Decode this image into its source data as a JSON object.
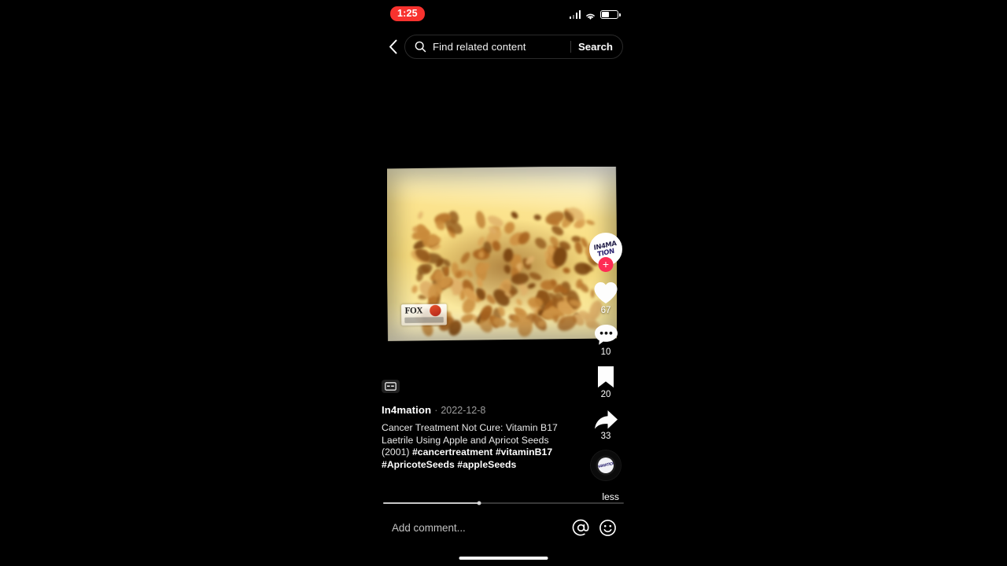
{
  "status_bar": {
    "time": "1:25",
    "time_pill_color": "#f8322e",
    "signal_icon": "cellular-signal-icon",
    "wifi_icon": "wifi-icon",
    "battery_icon": "battery-icon",
    "battery_level_pct": 45
  },
  "header": {
    "back_icon": "chevron-left-icon",
    "search_icon": "search-icon",
    "search_placeholder": "Find related content",
    "search_button_label": "Search"
  },
  "video": {
    "watermark": "FOX",
    "cc_icon": "closed-caption-icon",
    "description": "Blurry vintage news footage of apricot and apple seeds on a yellow surface"
  },
  "actions": {
    "avatar": {
      "name": "creator-avatar",
      "logo_line1": "IN4MA",
      "logo_line2": "TION",
      "follow_icon": "plus-icon"
    },
    "like": {
      "icon": "heart-icon",
      "count": "67"
    },
    "comment": {
      "icon": "comment-bubble-icon",
      "count": "10"
    },
    "bookmark": {
      "icon": "bookmark-icon",
      "count": "20"
    },
    "share": {
      "icon": "share-arrow-icon",
      "count": "33"
    },
    "music_disc": {
      "icon": "music-disc-icon",
      "art_text": "IN4MATION"
    }
  },
  "post": {
    "author": "In4mation",
    "separator": "·",
    "date": "2022-12-8",
    "caption_text": "Cancer Treatment Not Cure: Vitamin B17 Laetrile Using Apple and Apricot Seeds (2001) ",
    "hashtags": "#cancertreatment #vitaminB17 #ApricoteSeeds #appleSeeds",
    "collapse_label": "less"
  },
  "progress": {
    "percent": 40
  },
  "comment_bar": {
    "placeholder": "Add comment...",
    "mention_icon": "at-mention-icon",
    "emoji_icon": "emoji-smiley-icon"
  }
}
